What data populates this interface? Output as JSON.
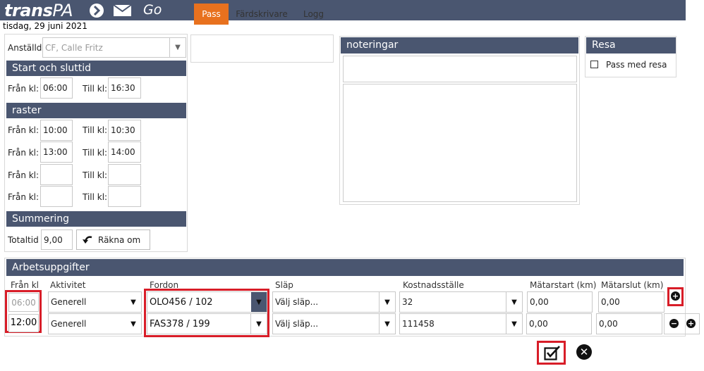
{
  "app": {
    "logo_main": "trans",
    "logo_suffix": "PA",
    "go_label": "Go",
    "date": "tisdag, 29 juni 2021"
  },
  "employee": {
    "label": "Anställd",
    "value": "CF, Calle Fritz"
  },
  "start_end": {
    "title": "Start och sluttid",
    "from_label": "Från kl:",
    "from": "06:00",
    "to_label": "Till kl:",
    "to": "16:30"
  },
  "breaks": {
    "title": "raster",
    "from_label": "Från kl:",
    "to_label": "Till kl:",
    "rows": [
      {
        "from": "10:00",
        "to": "10:30"
      },
      {
        "from": "13:00",
        "to": "14:00"
      },
      {
        "from": "",
        "to": ""
      },
      {
        "from": "",
        "to": ""
      }
    ]
  },
  "summary": {
    "title": "Summering",
    "total_label": "Totaltid",
    "total": "9,00",
    "recalc_label": "Räkna om"
  },
  "tabs": [
    {
      "label": "Pass"
    },
    {
      "label": "Färdskrivare"
    },
    {
      "label": "Logg"
    }
  ],
  "notes": {
    "title": "noteringar"
  },
  "trip": {
    "title": "Resa",
    "checkbox_label": "Pass med resa"
  },
  "tasks": {
    "title": "Arbetsuppgifter",
    "columns": [
      "Från kl",
      "Aktivitet",
      "Fordon",
      "Släp",
      "Kostnadsställe",
      "Mätarstart (km)",
      "Mätarslut (km)"
    ],
    "rows": [
      {
        "from": "06:00",
        "activity": "Generell",
        "vehicle": "OLO456 / 102",
        "trailer": "Välj släp...",
        "cost_center": "32",
        "meter_start": "0,00",
        "meter_end": "0,00"
      },
      {
        "from": "12:00",
        "activity": "Generell",
        "vehicle": "FAS378 / 199",
        "trailer": "Välj släp...",
        "cost_center": "111458",
        "meter_start": "0,00",
        "meter_end": "0,00"
      }
    ]
  },
  "colors": {
    "header": "#4a5670",
    "active_tab": "#e8711e",
    "highlight": "#d81d28"
  },
  "icons": {
    "arrow": "chevron-right-circle-icon",
    "mail": "envelope-icon",
    "recalc": "undo-arrow-icon",
    "add": "plus-circle-icon",
    "remove": "minus-circle-icon",
    "save": "checkbox-edit-icon",
    "cancel": "close-circle-icon"
  }
}
